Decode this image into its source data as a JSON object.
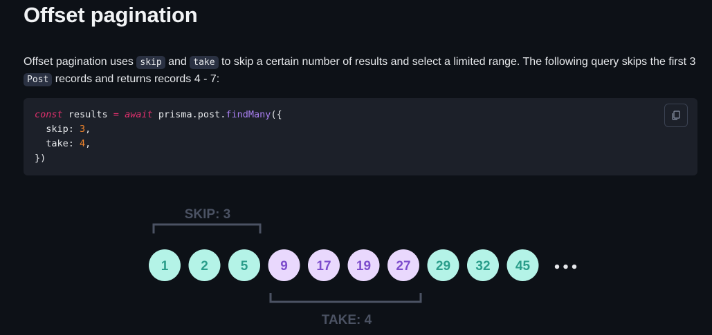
{
  "heading": "Offset pagination",
  "intro": {
    "part1": "Offset pagination uses ",
    "code_skip": "skip",
    "part2": " and ",
    "code_take": "take",
    "part3": " to skip a certain number of results and select a limited range. The following query skips the first 3 ",
    "code_post": "Post",
    "part4": " records and returns records 4 - 7:"
  },
  "code": {
    "line1": {
      "const": "const",
      "var": " results ",
      "eq": "=",
      "await": " await",
      "call": " prisma.post.",
      "method": "findMany",
      "open": "({"
    },
    "line2": {
      "prop": "  skip: ",
      "value": "3",
      "comma": ","
    },
    "line3": {
      "prop": "  take: ",
      "value": "4",
      "comma": ","
    },
    "line4": "})"
  },
  "copy_icon": "copy-icon",
  "diagram": {
    "skip_label": "SKIP: 3",
    "take_label": "TAKE: 4",
    "records": [
      {
        "label": "1",
        "group": "skip"
      },
      {
        "label": "2",
        "group": "skip"
      },
      {
        "label": "5",
        "group": "skip"
      },
      {
        "label": "9",
        "group": "take"
      },
      {
        "label": "17",
        "group": "take"
      },
      {
        "label": "19",
        "group": "take"
      },
      {
        "label": "27",
        "group": "take"
      },
      {
        "label": "29",
        "group": "rest"
      },
      {
        "label": "32",
        "group": "rest"
      },
      {
        "label": "45",
        "group": "rest"
      }
    ],
    "ellipsis": "•••",
    "colors": {
      "skip_fill": "#b4f3e7",
      "skip_text": "#2a9d8a",
      "take_fill": "#e9d8fd",
      "take_text": "#7c4ccc",
      "bracket": "#4b5263",
      "label": "#4b5263"
    }
  }
}
